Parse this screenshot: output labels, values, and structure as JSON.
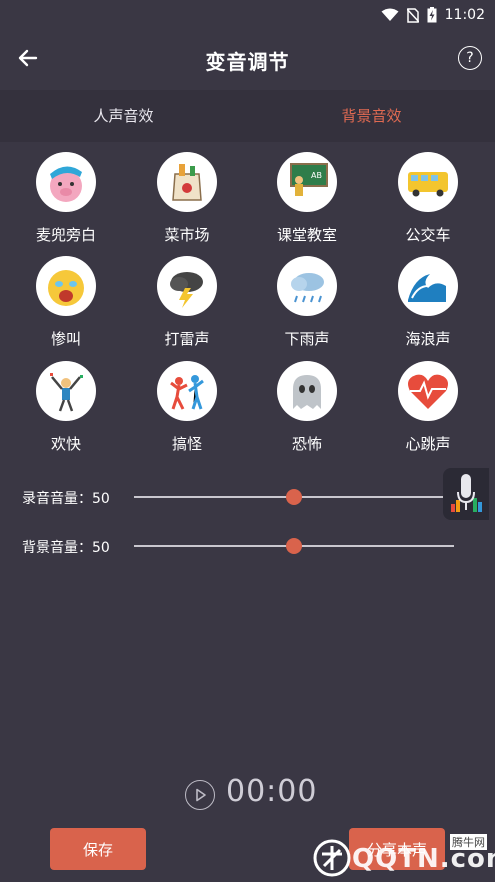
{
  "status_bar": {
    "time": "11:02",
    "icons": [
      "wifi-icon",
      "no-sim-icon",
      "battery-charging-icon"
    ]
  },
  "header": {
    "title": "变音调节",
    "back_icon": "arrow-left-icon",
    "help_label": "?"
  },
  "tabs": [
    {
      "label": "人声音效",
      "active": false
    },
    {
      "label": "背景音效",
      "active": true
    }
  ],
  "colors": {
    "background": "#3a3744",
    "accent": "#d9634c",
    "active_tab": "#e06a52"
  },
  "effects": [
    {
      "label": "麦兜旁白",
      "icon": "pig-icon"
    },
    {
      "label": "菜市场",
      "icon": "grocery-bag-icon"
    },
    {
      "label": "课堂教室",
      "icon": "classroom-icon"
    },
    {
      "label": "公交车",
      "icon": "bus-icon"
    },
    {
      "label": "惨叫",
      "icon": "screaming-face-icon"
    },
    {
      "label": "打雷声",
      "icon": "thunder-cloud-icon"
    },
    {
      "label": "下雨声",
      "icon": "rain-cloud-icon"
    },
    {
      "label": "海浪声",
      "icon": "wave-icon"
    },
    {
      "label": "欢快",
      "icon": "cheer-icon"
    },
    {
      "label": "搞怪",
      "icon": "dancing-icon"
    },
    {
      "label": "恐怖",
      "icon": "ghost-icon"
    },
    {
      "label": "心跳声",
      "icon": "heartbeat-icon"
    }
  ],
  "sliders": {
    "record": {
      "label": "录音音量：50",
      "value": 50,
      "max": 100
    },
    "background": {
      "label": "背景音量：50",
      "value": 50,
      "max": 100
    }
  },
  "player": {
    "time": "00:00"
  },
  "actions": {
    "save_label": "保存",
    "share_label": "分享本声"
  },
  "watermark": {
    "text": "QQTN.com",
    "small": "腾牛网"
  }
}
